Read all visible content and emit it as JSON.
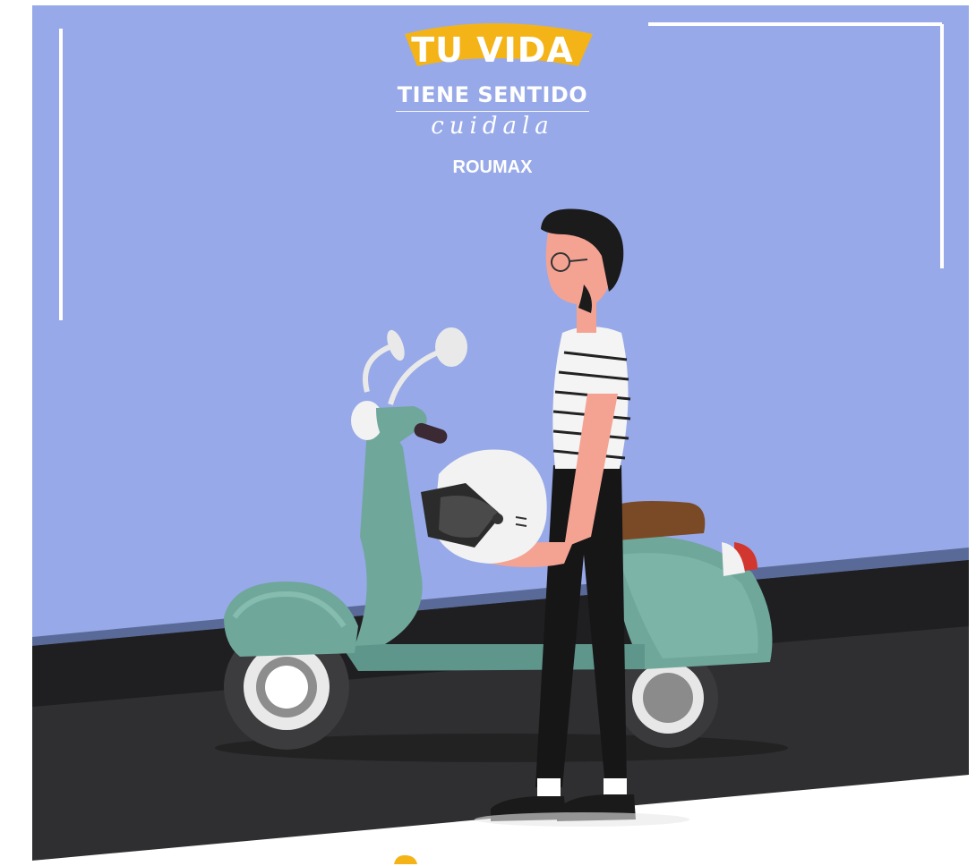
{
  "logo": {
    "title": "TU VIDA",
    "subtitle": "TIENE SENTIDO",
    "script": "cuidala",
    "brand": "ROUMAX"
  },
  "colors": {
    "sky": "#97a9e8",
    "banner": "#f4b418",
    "road": "#2c2c2e",
    "scooter": "#6fa79b",
    "seat": "#7a4a26",
    "frame_lines": "#ffffff"
  }
}
